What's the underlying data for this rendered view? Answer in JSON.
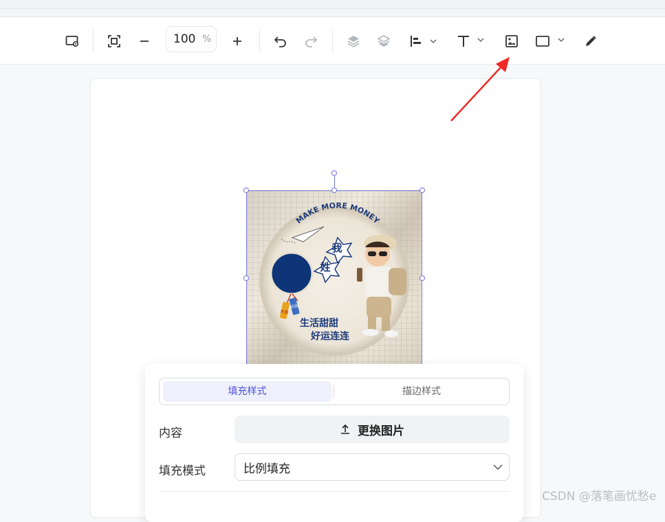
{
  "toolbar": {
    "zoom_value": "100",
    "zoom_unit": "%",
    "icons": [
      "canvas-settings-icon",
      "fit-screen-icon",
      "zoom-out-icon",
      "zoom-in-icon",
      "undo-icon",
      "redo-icon",
      "layer-up-icon",
      "layer-down-icon",
      "align-icon",
      "text-icon",
      "image-icon",
      "shape-rect-icon",
      "pen-icon"
    ]
  },
  "image": {
    "arc_text": "MAKE MORE MONEY",
    "char_1": "我",
    "char_2": "姓",
    "line_1": "生活甜甜",
    "line_2": "好运连连",
    "tag_a": "大吉",
    "tag_b": "好运",
    "colors": {
      "circle": "#0d3578",
      "text": "#1c3a7a"
    }
  },
  "panel": {
    "tabs": [
      {
        "label": "填充样式",
        "active": true
      },
      {
        "label": "描边样式",
        "active": false
      }
    ],
    "content_label": "内容",
    "replace_button": "更换图片",
    "fill_mode_label": "填充模式",
    "fill_mode_value": "比例填充"
  },
  "watermark": "CSDN @落笔画忧愁e",
  "colors": {
    "accent": "#4b4fd6",
    "arrow": "#ee2a24"
  }
}
